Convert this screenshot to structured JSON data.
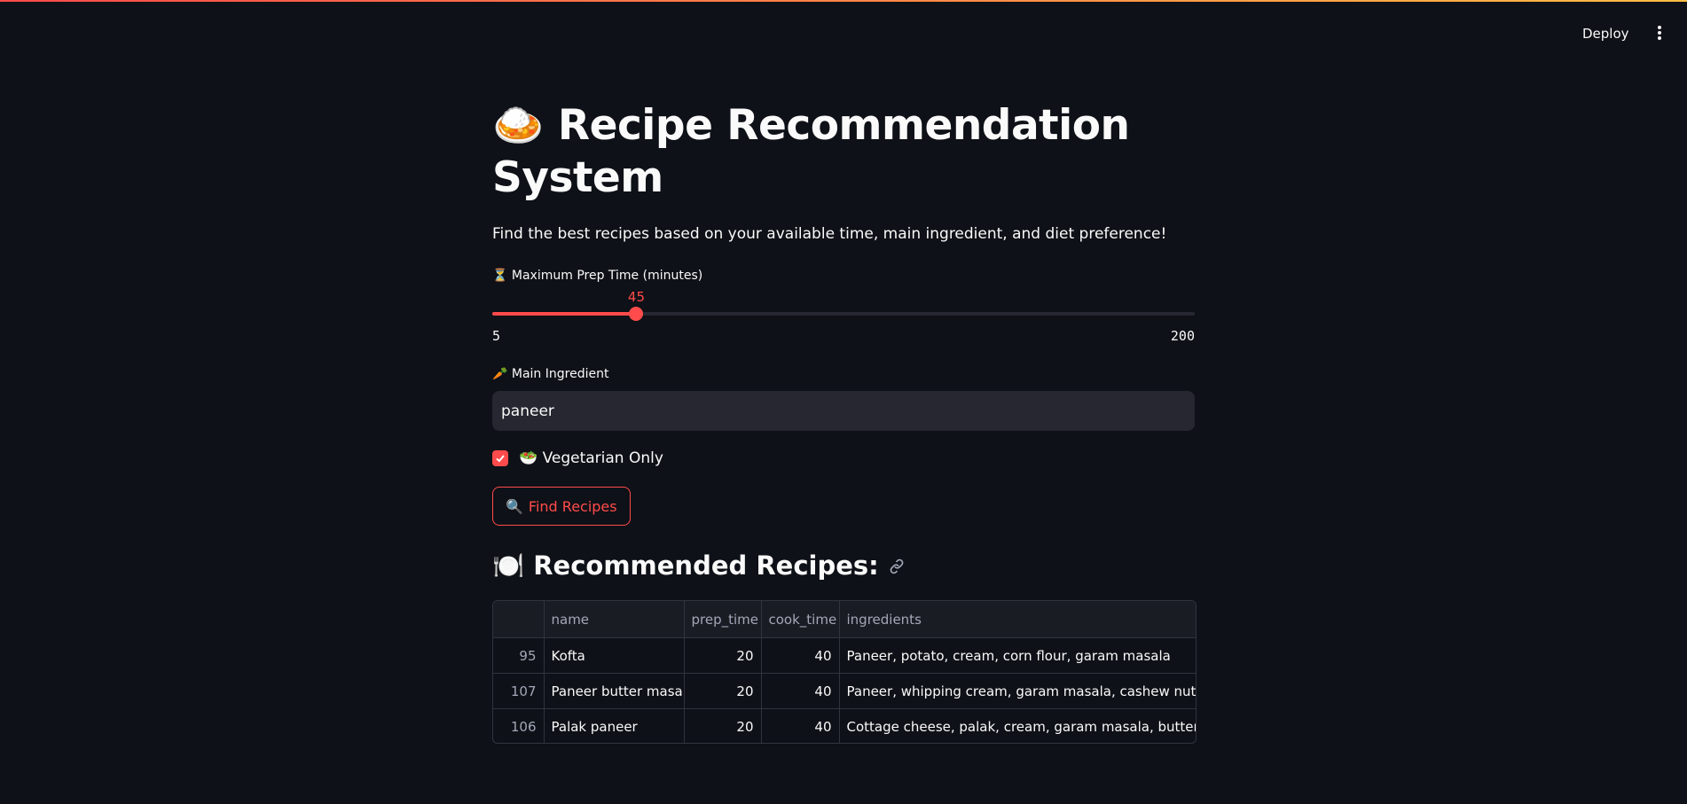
{
  "header": {
    "deploy_label": "Deploy",
    "menu_icon": "kebab-menu-icon"
  },
  "accent_color": "#ff4b4b",
  "page": {
    "title": "🍛 Recipe Recommendation System",
    "subtitle": "Find the best recipes based on your available time, main ingredient, and diet preference!"
  },
  "slider": {
    "label": "⏳ Maximum Prep Time (minutes)",
    "value": 45,
    "value_text": "45",
    "min": 5,
    "max": 200,
    "min_text": "5",
    "max_text": "200"
  },
  "ingredient": {
    "label": "🥕 Main Ingredient",
    "value": "paneer"
  },
  "vegetarian": {
    "label": "🥗 Vegetarian Only",
    "checked": true
  },
  "find_button": {
    "icon": "🔍",
    "label": "Find Recipes"
  },
  "results": {
    "heading": "🍽️ Recommended Recipes:",
    "columns": [
      "",
      "name",
      "prep_time",
      "cook_time",
      "ingredients"
    ],
    "rows": [
      {
        "index": "95",
        "name": "Kofta",
        "prep_time": "20",
        "cook_time": "40",
        "ingredients": "Paneer, potato, cream, corn flour, garam masala"
      },
      {
        "index": "107",
        "name": "Paneer butter masala",
        "prep_time": "20",
        "cook_time": "40",
        "ingredients": "Paneer, whipping cream, garam masala, cashew nuts, butter"
      },
      {
        "index": "106",
        "name": "Palak paneer",
        "prep_time": "20",
        "cook_time": "40",
        "ingredients": "Cottage cheese, palak, cream, garam masala, butter"
      }
    ]
  }
}
